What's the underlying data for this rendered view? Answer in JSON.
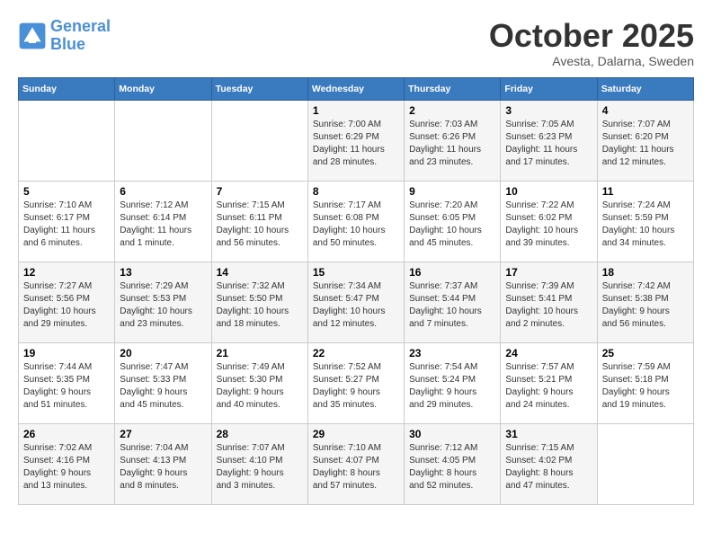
{
  "logo": {
    "line1": "General",
    "line2": "Blue"
  },
  "title": "October 2025",
  "location": "Avesta, Dalarna, Sweden",
  "days_of_week": [
    "Sunday",
    "Monday",
    "Tuesday",
    "Wednesday",
    "Thursday",
    "Friday",
    "Saturday"
  ],
  "weeks": [
    [
      {
        "num": "",
        "info": ""
      },
      {
        "num": "",
        "info": ""
      },
      {
        "num": "",
        "info": ""
      },
      {
        "num": "1",
        "info": "Sunrise: 7:00 AM\nSunset: 6:29 PM\nDaylight: 11 hours\nand 28 minutes."
      },
      {
        "num": "2",
        "info": "Sunrise: 7:03 AM\nSunset: 6:26 PM\nDaylight: 11 hours\nand 23 minutes."
      },
      {
        "num": "3",
        "info": "Sunrise: 7:05 AM\nSunset: 6:23 PM\nDaylight: 11 hours\nand 17 minutes."
      },
      {
        "num": "4",
        "info": "Sunrise: 7:07 AM\nSunset: 6:20 PM\nDaylight: 11 hours\nand 12 minutes."
      }
    ],
    [
      {
        "num": "5",
        "info": "Sunrise: 7:10 AM\nSunset: 6:17 PM\nDaylight: 11 hours\nand 6 minutes."
      },
      {
        "num": "6",
        "info": "Sunrise: 7:12 AM\nSunset: 6:14 PM\nDaylight: 11 hours\nand 1 minute."
      },
      {
        "num": "7",
        "info": "Sunrise: 7:15 AM\nSunset: 6:11 PM\nDaylight: 10 hours\nand 56 minutes."
      },
      {
        "num": "8",
        "info": "Sunrise: 7:17 AM\nSunset: 6:08 PM\nDaylight: 10 hours\nand 50 minutes."
      },
      {
        "num": "9",
        "info": "Sunrise: 7:20 AM\nSunset: 6:05 PM\nDaylight: 10 hours\nand 45 minutes."
      },
      {
        "num": "10",
        "info": "Sunrise: 7:22 AM\nSunset: 6:02 PM\nDaylight: 10 hours\nand 39 minutes."
      },
      {
        "num": "11",
        "info": "Sunrise: 7:24 AM\nSunset: 5:59 PM\nDaylight: 10 hours\nand 34 minutes."
      }
    ],
    [
      {
        "num": "12",
        "info": "Sunrise: 7:27 AM\nSunset: 5:56 PM\nDaylight: 10 hours\nand 29 minutes."
      },
      {
        "num": "13",
        "info": "Sunrise: 7:29 AM\nSunset: 5:53 PM\nDaylight: 10 hours\nand 23 minutes."
      },
      {
        "num": "14",
        "info": "Sunrise: 7:32 AM\nSunset: 5:50 PM\nDaylight: 10 hours\nand 18 minutes."
      },
      {
        "num": "15",
        "info": "Sunrise: 7:34 AM\nSunset: 5:47 PM\nDaylight: 10 hours\nand 12 minutes."
      },
      {
        "num": "16",
        "info": "Sunrise: 7:37 AM\nSunset: 5:44 PM\nDaylight: 10 hours\nand 7 minutes."
      },
      {
        "num": "17",
        "info": "Sunrise: 7:39 AM\nSunset: 5:41 PM\nDaylight: 10 hours\nand 2 minutes."
      },
      {
        "num": "18",
        "info": "Sunrise: 7:42 AM\nSunset: 5:38 PM\nDaylight: 9 hours\nand 56 minutes."
      }
    ],
    [
      {
        "num": "19",
        "info": "Sunrise: 7:44 AM\nSunset: 5:35 PM\nDaylight: 9 hours\nand 51 minutes."
      },
      {
        "num": "20",
        "info": "Sunrise: 7:47 AM\nSunset: 5:33 PM\nDaylight: 9 hours\nand 45 minutes."
      },
      {
        "num": "21",
        "info": "Sunrise: 7:49 AM\nSunset: 5:30 PM\nDaylight: 9 hours\nand 40 minutes."
      },
      {
        "num": "22",
        "info": "Sunrise: 7:52 AM\nSunset: 5:27 PM\nDaylight: 9 hours\nand 35 minutes."
      },
      {
        "num": "23",
        "info": "Sunrise: 7:54 AM\nSunset: 5:24 PM\nDaylight: 9 hours\nand 29 minutes."
      },
      {
        "num": "24",
        "info": "Sunrise: 7:57 AM\nSunset: 5:21 PM\nDaylight: 9 hours\nand 24 minutes."
      },
      {
        "num": "25",
        "info": "Sunrise: 7:59 AM\nSunset: 5:18 PM\nDaylight: 9 hours\nand 19 minutes."
      }
    ],
    [
      {
        "num": "26",
        "info": "Sunrise: 7:02 AM\nSunset: 4:16 PM\nDaylight: 9 hours\nand 13 minutes."
      },
      {
        "num": "27",
        "info": "Sunrise: 7:04 AM\nSunset: 4:13 PM\nDaylight: 9 hours\nand 8 minutes."
      },
      {
        "num": "28",
        "info": "Sunrise: 7:07 AM\nSunset: 4:10 PM\nDaylight: 9 hours\nand 3 minutes."
      },
      {
        "num": "29",
        "info": "Sunrise: 7:10 AM\nSunset: 4:07 PM\nDaylight: 8 hours\nand 57 minutes."
      },
      {
        "num": "30",
        "info": "Sunrise: 7:12 AM\nSunset: 4:05 PM\nDaylight: 8 hours\nand 52 minutes."
      },
      {
        "num": "31",
        "info": "Sunrise: 7:15 AM\nSunset: 4:02 PM\nDaylight: 8 hours\nand 47 minutes."
      },
      {
        "num": "",
        "info": ""
      }
    ]
  ]
}
